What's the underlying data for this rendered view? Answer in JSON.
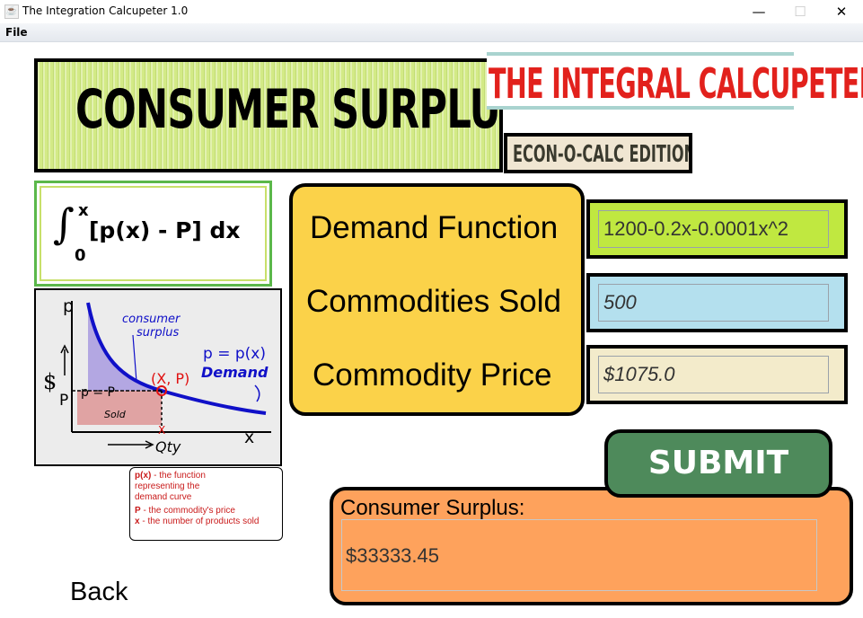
{
  "window": {
    "title": "The Integration Calcupeter 1.0",
    "icon": "java-cup-icon",
    "minimize": "—",
    "maximize": "☐",
    "close": "✕"
  },
  "menu": {
    "file": "File"
  },
  "banner": {
    "main": "CONSUMER SURPLUS",
    "app_name": "THE INTEGRAL CALCUPETER",
    "edition": "ECON-O-CALC EDITION"
  },
  "formula": {
    "integral_symbol": "∫",
    "upper_limit": "x",
    "lower_limit": "0",
    "integrand": "[p(x) - P] dx"
  },
  "graph": {
    "y_axis": "p",
    "dollar": "$",
    "p_level": "P",
    "p_eq": "p = P",
    "consumer_surplus": [
      "consumer",
      "surplus"
    ],
    "curve_label": "p = p(x)",
    "demand": "Demand",
    "point_label": "(X, P)",
    "sold": "Sold",
    "x_mark": "X",
    "qty": "Qty",
    "x_axis": "x"
  },
  "legend": {
    "px_term": "p(x)",
    "px_desc_1": " - the function",
    "px_desc_2": "representing the",
    "px_desc_3": "demand curve",
    "P_term": "P",
    "P_desc": " - the commodity's price",
    "x_term": "x",
    "x_desc": " - the number of products sold"
  },
  "form": {
    "demand_label": "Demand Function",
    "demand_value": "1200-0.2x-0.0001x^2",
    "sold_label": "Commodities Sold",
    "sold_value": "500",
    "price_label": "Commodity Price",
    "price_value": "$1075.0"
  },
  "submit": "SUBMIT",
  "result": {
    "label": "Consumer Surplus:",
    "value": "$33333.45"
  },
  "back": "Back",
  "colors": {
    "sketch_green": "#d3ea86",
    "title_red": "#e2211c",
    "teal_band": "#a9d3cf",
    "label_panel_yellow": "#fbd249",
    "demand_field_green": "#c0e840",
    "sold_field_blue": "#b4e0ee",
    "price_field_beige": "#f3ebcb",
    "submit_green": "#4e8a5b",
    "result_orange": "#fea25c",
    "formula_border_green": "#5bb84a"
  }
}
